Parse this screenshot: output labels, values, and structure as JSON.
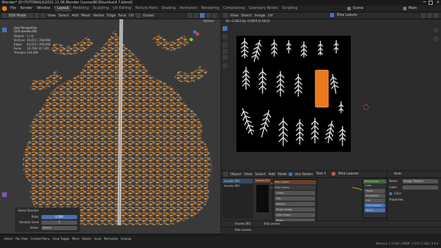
{
  "titlebar": {
    "text": "Blender* [D:\\TUTORIALS\\2021.11.06 Blender Course\\BC\\Ekushka\\4.7.blend]"
  },
  "menu": [
    "File",
    "Render",
    "Window",
    "Help"
  ],
  "workspaces": [
    "Layout",
    "Modeling",
    "Sculpting",
    "UV Editing",
    "Texture Paint",
    "Shading",
    "Animation",
    "Rendering",
    "Compositing",
    "Geometry Nodes",
    "Scripting"
  ],
  "active_workspace": "Layout",
  "scene_label": "Scene",
  "view_layer_label": "Main",
  "viewport": {
    "header": [
      "Edit Mode",
      "View",
      "Select",
      "Add",
      "Mesh",
      "Vertex",
      "Edge",
      "Face",
      "UV"
    ],
    "transform": "Global",
    "options_label": "Options",
    "overlay_title": "User Perspective",
    "overlay_obj": "(2/3) Isavets.001",
    "stats": [
      {
        "k": "Objects",
        "v": "1 / 8"
      },
      {
        "k": "Vertices",
        "v": "43,072 / 268,984"
      },
      {
        "k": "Edges",
        "v": "43,072 / 268,984"
      },
      {
        "k": "Faces",
        "v": "10,768 / 67,246"
      },
      {
        "k": "Triangles",
        "v": "134,492"
      }
    ],
    "op_panel": {
      "title": "Select Random",
      "rows": [
        {
          "k": "Ratio",
          "v": "0.500"
        },
        {
          "k": "Random Seed",
          "v": "0"
        },
        {
          "k": "Action",
          "v": "Select"
        }
      ]
    }
  },
  "uv_editor": {
    "header": [
      "View",
      "Select",
      "Image",
      "UV"
    ],
    "readout": "Dn: 0.3613  Dy: 0.0059 (0.3613)",
    "image_name": "Elka Leaves",
    "highlight_color": "#e8781e",
    "sprite_color": "#e0e0e0"
  },
  "node_editor": {
    "header": [
      "Object",
      "View",
      "Select",
      "Add",
      "Node",
      "Use Nodes"
    ],
    "slot": "Slot 1",
    "material": "Elka Leaves",
    "node_principled": "Elka Leaves",
    "node_principled_fields": [
      "Linear",
      "Flat",
      "Repeat",
      "Single Image",
      "Color Space",
      "Alpha"
    ],
    "node_output": "Color",
    "node_right": "Elka Leaves",
    "list_items": [
      "Isavets.001",
      "Isavets.001"
    ],
    "list_icon_label": "Isavets.001"
  },
  "properties": {
    "name": "Elka...",
    "node_label": "Node",
    "fields": [
      {
        "k": "Name",
        "v": "Image Texture"
      },
      {
        "k": "Label",
        "v": ""
      }
    ],
    "rows": [
      "Transl",
      "Roughness",
      "IOR",
      "Transmission",
      "Alpha"
    ],
    "row_vals": [
      "1.00",
      "0.500",
      "1.45",
      "0.000",
      "1.000"
    ],
    "color_label": "Color",
    "properties_label": "Properties"
  },
  "outliner_bottom": {
    "items": [
      {
        "icon": "Isavets.001",
        "label": "Elka Leaves"
      },
      {
        "icon": "",
        "label": "Elka Leaves"
      }
    ]
  },
  "statusbar": {
    "items": [
      "Select",
      "Pan View",
      "Context Menu",
      "Snap Toggle",
      "Move",
      "Rotate",
      "Scale",
      "Normalize",
      "Unwrap"
    ],
    "stats": "Memory: 1.2 GiB | VRAM: 1.5/11.3 GiB | 3.0.0"
  },
  "colors": {
    "accent": "#4772b3",
    "orange": "#e8781e",
    "panel": "#2b2b2b"
  }
}
